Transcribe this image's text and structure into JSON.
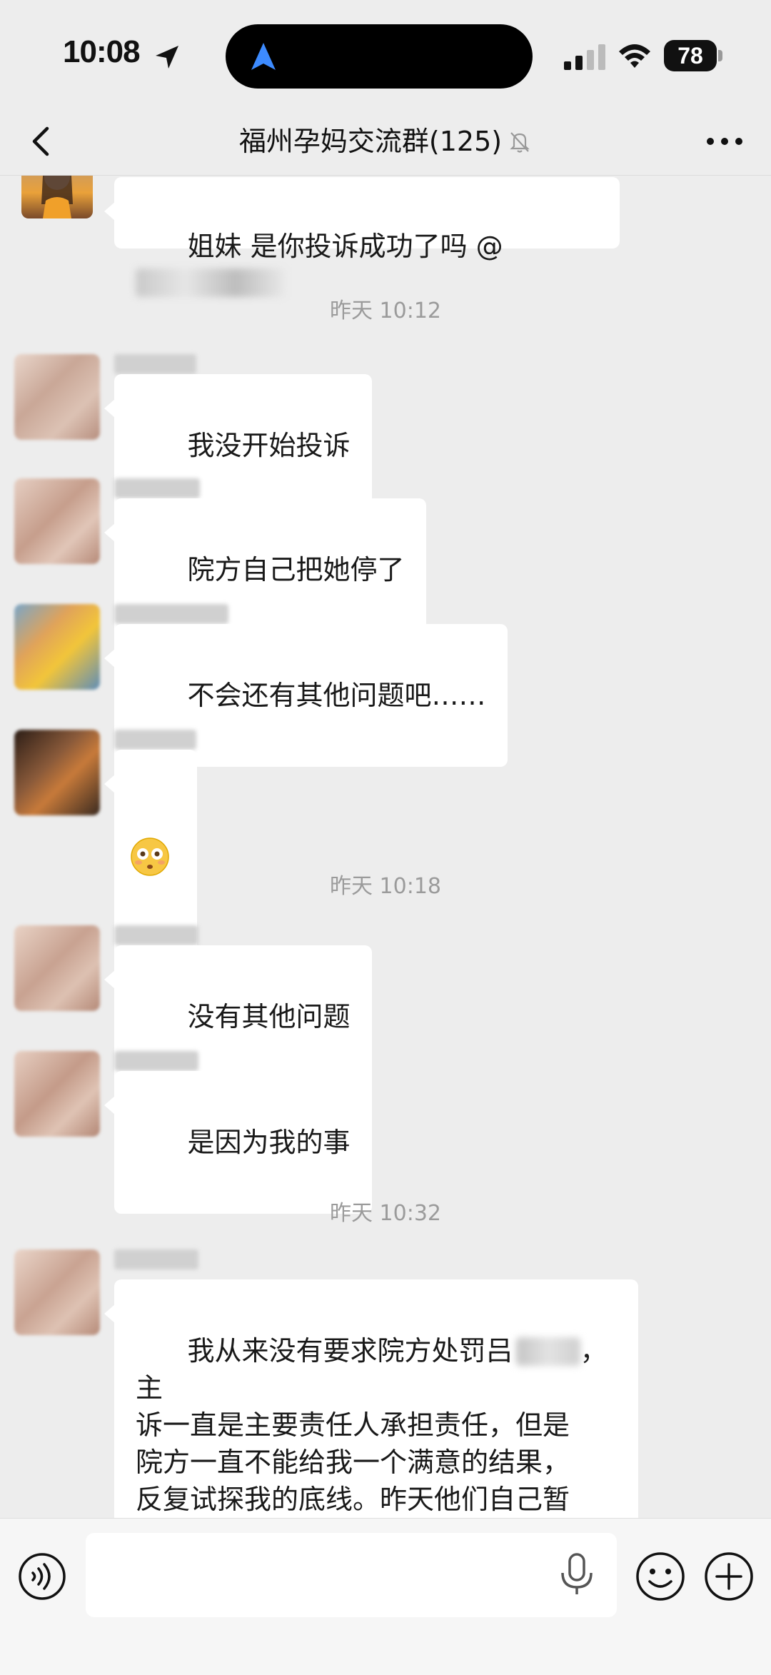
{
  "status_bar": {
    "time": "10:08",
    "battery": "78"
  },
  "nav": {
    "title": "福州孕妈交流群(125)"
  },
  "messages": {
    "m0": {
      "text_before_mention": "姐妹 是你投诉成功了吗 @"
    },
    "ts1": "昨天 10:12",
    "m1": {
      "text": "我没开始投诉"
    },
    "m2": {
      "text": "院方自己把她停了"
    },
    "m3": {
      "text": "不会还有其他问题吧……"
    },
    "m4": {
      "emoji": "flushed-face"
    },
    "ts2": "昨天 10:18",
    "m5": {
      "text": "没有其他问题"
    },
    "m6": {
      "text": "是因为我的事"
    },
    "ts3": "昨天 10:32",
    "m7": {
      "line1_before": "我从来没有要求院方处罚吕",
      "line1_after": "， 主",
      "rest": "诉一直是主要责任人承担责任，但是\n院方一直不能给我一个满意的结果，\n反复试探我的底线。昨天他们自己暂\n停了所有涉事人员的工作"
    }
  },
  "input": {
    "placeholder": ""
  },
  "colors": {
    "background": "#ededed",
    "bubble": "#ffffff",
    "timestamp": "#9b9b9b"
  }
}
